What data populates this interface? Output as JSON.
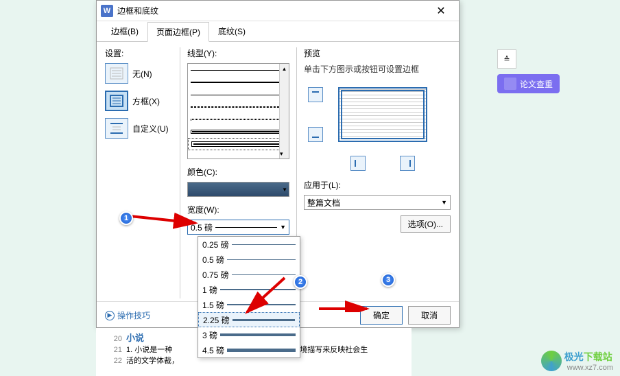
{
  "dialog": {
    "title": "边框和底纹",
    "tabs": {
      "border": "边框(B)",
      "page": "页面边框(P)",
      "shading": "底纹(S)"
    },
    "settings_label": "设置:",
    "settings": {
      "none": "无(N)",
      "box": "方框(X)",
      "custom": "自定义(U)"
    },
    "linetype_label": "线型(Y):",
    "color_label": "颜色(C):",
    "width_label": "宽度(W):",
    "width_value": "0.5  磅",
    "width_options": [
      "0.25 磅",
      "0.5  磅",
      "0.75 磅",
      "1    磅",
      "1.5  磅",
      "2.25 磅",
      "3    磅",
      "4.5  磅"
    ],
    "preview_label": "预览",
    "preview_hint": "单击下方图示或按钮可设置边框",
    "apply_label": "应用于(L):",
    "apply_value": "整篇文档",
    "options_btn": "选项(O)...",
    "tips": "操作技巧",
    "ok": "确定",
    "cancel": "取消"
  },
  "side": {
    "check": "论文查重"
  },
  "doc": {
    "title": "小说",
    "line1": "1. 小说是一种",
    "line1b": "故事情节和环境描写来反映社会生",
    "line2": "活的文学体裁，",
    "n20": "20",
    "n21": "21",
    "n22": "22"
  },
  "logo": {
    "a": "极光",
    "b": "下载站",
    "url": "www.xz7.com"
  },
  "anno": {
    "a": "1",
    "b": "2",
    "c": "3"
  }
}
